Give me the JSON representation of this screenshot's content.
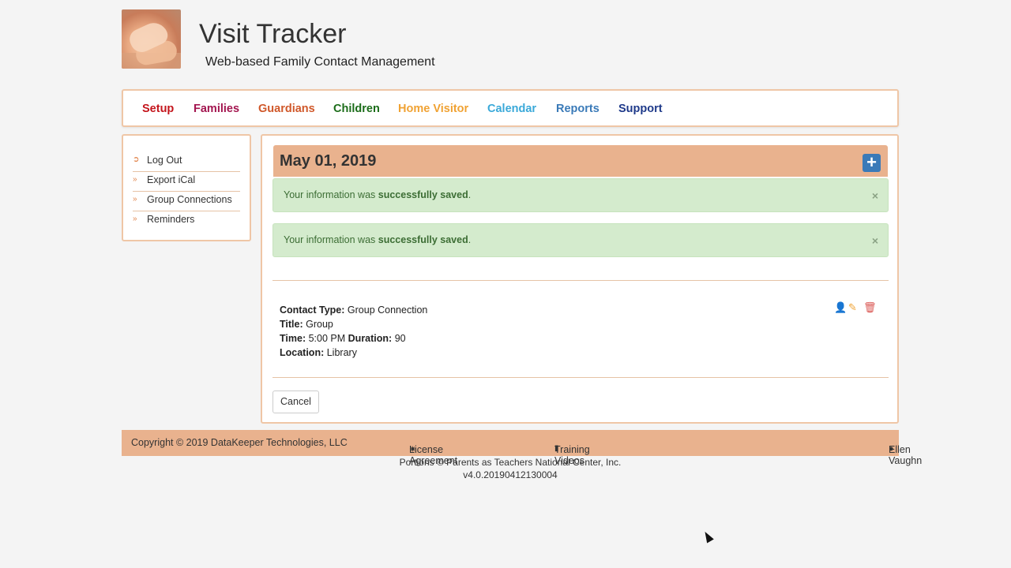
{
  "header": {
    "title": "Visit Tracker",
    "subtitle": "Web-based Family Contact Management"
  },
  "nav": [
    {
      "label": "Setup",
      "color": "#c4151c"
    },
    {
      "label": "Families",
      "color": "#a3154f"
    },
    {
      "label": "Guardians",
      "color": "#d0582a"
    },
    {
      "label": "Children",
      "color": "#1b6c19"
    },
    {
      "label": "Home Visitor",
      "color": "#f0a233"
    },
    {
      "label": "Calendar",
      "color": "#3aa9d9"
    },
    {
      "label": "Reports",
      "color": "#3a7ab8"
    },
    {
      "label": "Support",
      "color": "#1f3a8a"
    }
  ],
  "sidebar": {
    "items": [
      {
        "label": "Log Out",
        "icon": "sign-out-icon"
      },
      {
        "label": "Export iCal",
        "icon": "double-chevron-right-icon"
      },
      {
        "label": "Group Connections",
        "icon": "double-chevron-right-icon"
      },
      {
        "label": "Reminders",
        "icon": "double-chevron-right-icon"
      }
    ]
  },
  "main": {
    "date": "May 01, 2019",
    "alerts": [
      {
        "prefix": "Your information was ",
        "strong": "successfully saved",
        "suffix": "."
      },
      {
        "prefix": "Your information was ",
        "strong": "successfully saved",
        "suffix": "."
      }
    ],
    "details": {
      "contact_type_label": "Contact Type:",
      "contact_type": "Group Connection",
      "title_label": "Title:",
      "title": "Group",
      "time_label": "Time:",
      "time": "5:00 PM",
      "duration_label": "Duration:",
      "duration": "90",
      "location_label": "Location:",
      "location": "Library"
    },
    "cancel_label": "Cancel",
    "close_symbol": "×",
    "add_symbol": "+"
  },
  "footer": {
    "copyright": "Copyright © 2019 DataKeeper Technologies, LLC",
    "license": "License Agreement",
    "training": "Training Videos",
    "user": "Ellen Vaughn",
    "portions": "Portions © Parents as Teachers National Center, Inc.",
    "version": "v4.0.20190412130004"
  },
  "colors": {
    "accent": "#e9b28e",
    "border": "#efc6a6",
    "success_bg": "#d4ebcd",
    "primary": "#3a7ab8"
  }
}
